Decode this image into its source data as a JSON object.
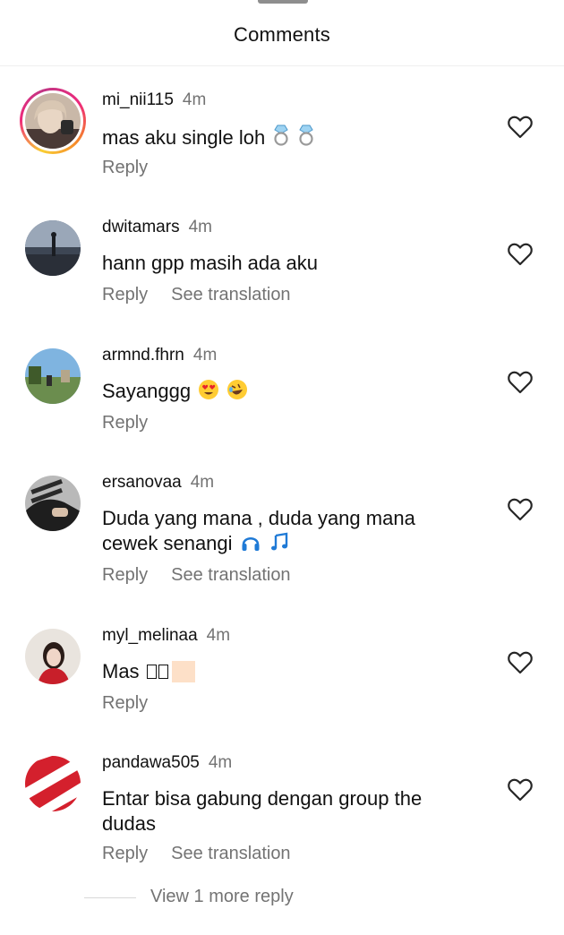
{
  "header": {
    "title": "Comments"
  },
  "comments": [
    {
      "username": "mi_nii115",
      "time": "4m",
      "text": "mas aku single loh",
      "emojis": [
        "ring",
        "ring"
      ],
      "actions": [
        "Reply"
      ],
      "has_story": true
    },
    {
      "username": "dwitamars",
      "time": "4m",
      "text": "hann gpp masih ada aku",
      "actions": [
        "Reply",
        "See translation"
      ]
    },
    {
      "username": "armnd.fhrn",
      "time": "4m",
      "text": "Sayanggg",
      "emojis": [
        "heart-eyes",
        "rofl"
      ],
      "actions": [
        "Reply"
      ]
    },
    {
      "username": "ersanovaa",
      "time": "4m",
      "text_line1": "Duda yang mana , duda yang mana",
      "text_line2": "cewek senangi",
      "emojis": [
        "headphone",
        "music-note"
      ],
      "actions": [
        "Reply",
        "See translation"
      ]
    },
    {
      "username": "myl_melinaa",
      "time": "4m",
      "text": "Mas",
      "actions": [
        "Reply"
      ]
    },
    {
      "username": "pandawa505",
      "time": "4m",
      "text_line1": "Entar bisa gabung dengan group the",
      "text_line2": "dudas",
      "actions": [
        "Reply",
        "See translation"
      ]
    }
  ],
  "more_replies": "View 1 more reply",
  "colors": {
    "secondary_text": "#737373",
    "primary_text": "#111111",
    "divider": "#efefef"
  }
}
